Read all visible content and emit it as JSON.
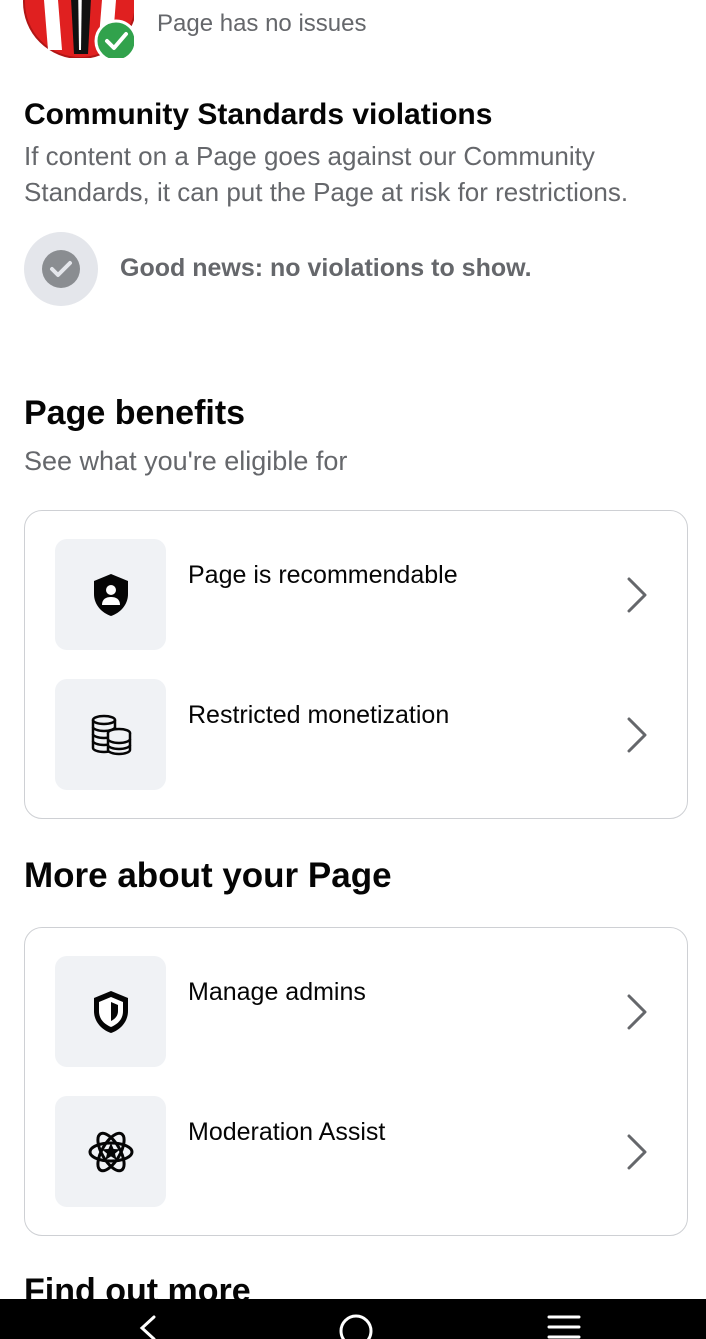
{
  "header": {
    "subtitle": "Page has no issues"
  },
  "community_standards": {
    "title": "Community Standards violations",
    "description": "If content on a Page goes against our Community Standards, it can put the Page at risk for restrictions.",
    "status": "Good news: no violations to show."
  },
  "page_benefits": {
    "title": "Page benefits",
    "subtitle": "See what you're eligible for",
    "items": [
      {
        "label": "Page is recommendable",
        "icon": "shield-person-icon"
      },
      {
        "label": "Restricted monetization",
        "icon": "coins-icon"
      }
    ]
  },
  "more_about": {
    "title": "More about your Page",
    "items": [
      {
        "label": "Manage admins",
        "icon": "shield-icon"
      },
      {
        "label": "Moderation Assist",
        "icon": "atom-star-icon"
      }
    ]
  },
  "find_out_more": {
    "title": "Find out more"
  },
  "nav": {
    "back": "back-icon",
    "home": "home-icon",
    "recents": "recents-icon"
  },
  "colors": {
    "text_primary": "#050505",
    "text_secondary": "#65676b",
    "icon_bg": "#f0f2f5",
    "success_green": "#31a24c",
    "avatar_red": "#e02020"
  }
}
